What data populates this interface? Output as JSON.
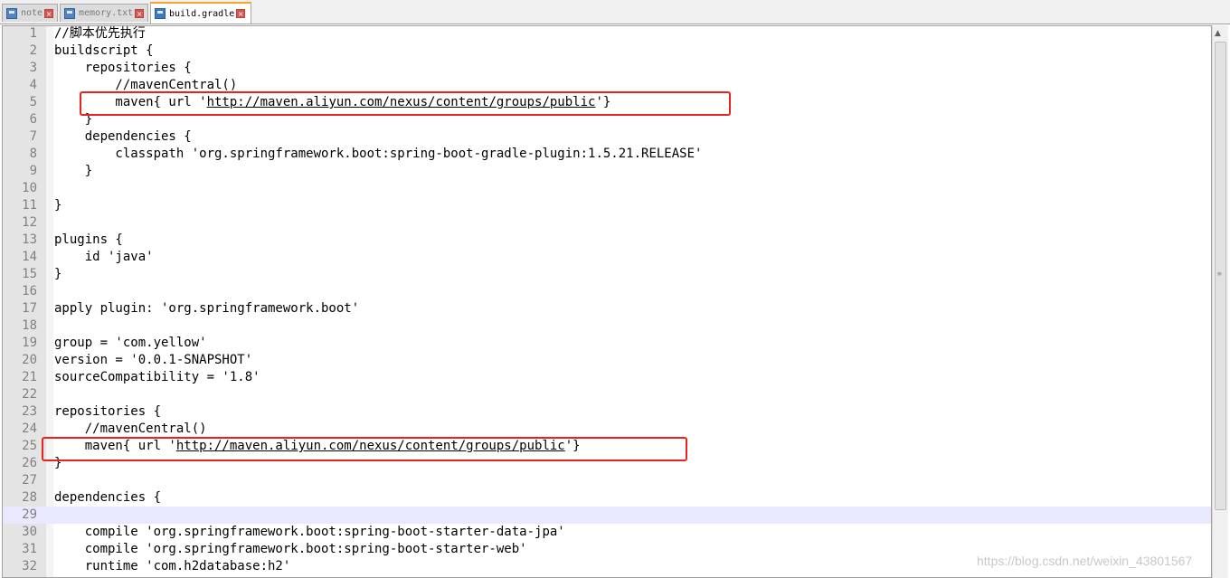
{
  "tabs": [
    {
      "label": "note",
      "active": false
    },
    {
      "label": "memory.txt",
      "active": false
    },
    {
      "label": "build.gradle",
      "active": true
    }
  ],
  "tab_close_glyph": "×",
  "editor": {
    "current_line": 29,
    "lines": [
      {
        "n": "1",
        "text": "//脚本优先执行"
      },
      {
        "n": "2",
        "text": "buildscript {"
      },
      {
        "n": "3",
        "text": "    repositories {"
      },
      {
        "n": "4",
        "text": "        //mavenCentral()"
      },
      {
        "n": "5",
        "text": "        maven{ url 'http://maven.aliyun.com/nexus/content/groups/public'}",
        "url": "http://maven.aliyun.com/nexus/content/groups/public"
      },
      {
        "n": "6",
        "text": "    }"
      },
      {
        "n": "7",
        "text": "    dependencies {"
      },
      {
        "n": "8",
        "text": "        classpath 'org.springframework.boot:spring-boot-gradle-plugin:1.5.21.RELEASE'"
      },
      {
        "n": "9",
        "text": "    }"
      },
      {
        "n": "10",
        "text": ""
      },
      {
        "n": "11",
        "text": "}"
      },
      {
        "n": "12",
        "text": ""
      },
      {
        "n": "13",
        "text": "plugins {"
      },
      {
        "n": "14",
        "text": "    id 'java'"
      },
      {
        "n": "15",
        "text": "}"
      },
      {
        "n": "16",
        "text": ""
      },
      {
        "n": "17",
        "text": "apply plugin: 'org.springframework.boot'"
      },
      {
        "n": "18",
        "text": ""
      },
      {
        "n": "19",
        "text": "group = 'com.yellow'"
      },
      {
        "n": "20",
        "text": "version = '0.0.1-SNAPSHOT'"
      },
      {
        "n": "21",
        "text": "sourceCompatibility = '1.8'"
      },
      {
        "n": "22",
        "text": ""
      },
      {
        "n": "23",
        "text": "repositories {"
      },
      {
        "n": "24",
        "text": "    //mavenCentral()"
      },
      {
        "n": "25",
        "text": "    maven{ url 'http://maven.aliyun.com/nexus/content/groups/public'}",
        "url": "http://maven.aliyun.com/nexus/content/groups/public"
      },
      {
        "n": "26",
        "text": "}"
      },
      {
        "n": "27",
        "text": ""
      },
      {
        "n": "28",
        "text": "dependencies {"
      },
      {
        "n": "29",
        "text": ""
      },
      {
        "n": "30",
        "text": "    compile 'org.springframework.boot:spring-boot-starter-data-jpa'"
      },
      {
        "n": "31",
        "text": "    compile 'org.springframework.boot:spring-boot-starter-web'"
      },
      {
        "n": "32",
        "text": "    runtime 'com.h2database:h2'"
      }
    ]
  },
  "annotation": {
    "color": "#e8231f",
    "boxed_lines": [
      5,
      25
    ]
  },
  "watermark": "https://blog.csdn.net/weixin_43801567",
  "icons": {
    "tab_file": "file-icon",
    "tab_close": "close-icon",
    "scroll_up": "arrow-up-icon"
  }
}
